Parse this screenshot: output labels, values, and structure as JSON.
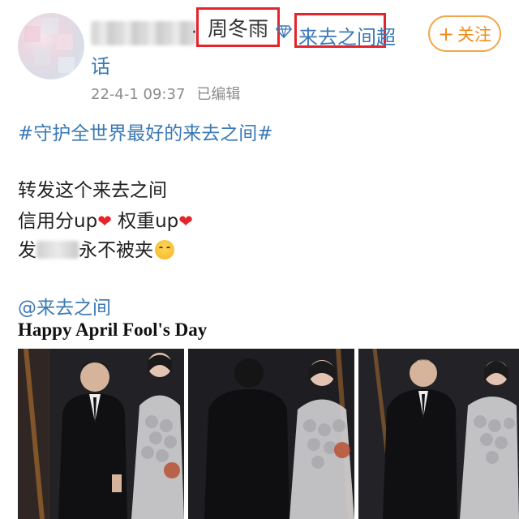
{
  "post": {
    "author_suffix": "·",
    "author_highlight": "周冬雨",
    "topic_line1": "来去之间超",
    "topic_line2": "话",
    "follow": {
      "plus": "+",
      "label": "关注"
    },
    "timestamp": "22-4-1 09:37",
    "edited": "已编辑",
    "hashtag": "#守护全世界最好的来去之间#",
    "lines": {
      "l1": "转发这个来去之间",
      "l2_a": "信用分up",
      "l2_b": " 权重up",
      "l3_a": "发",
      "l3_b": "永不被夹"
    },
    "hearts": "❤",
    "mention": "@来去之间",
    "caption": "Happy April Fool's Day"
  },
  "icons": {
    "avatar": "avatar",
    "diamond": "diamond-icon",
    "heart": "heart-emoji",
    "emoji": "blushing-face-emoji"
  },
  "colors": {
    "link": "#3b79b5",
    "highlight_box": "#e3242b",
    "follow": "#f08a1b",
    "meta": "#8c8c8c"
  }
}
